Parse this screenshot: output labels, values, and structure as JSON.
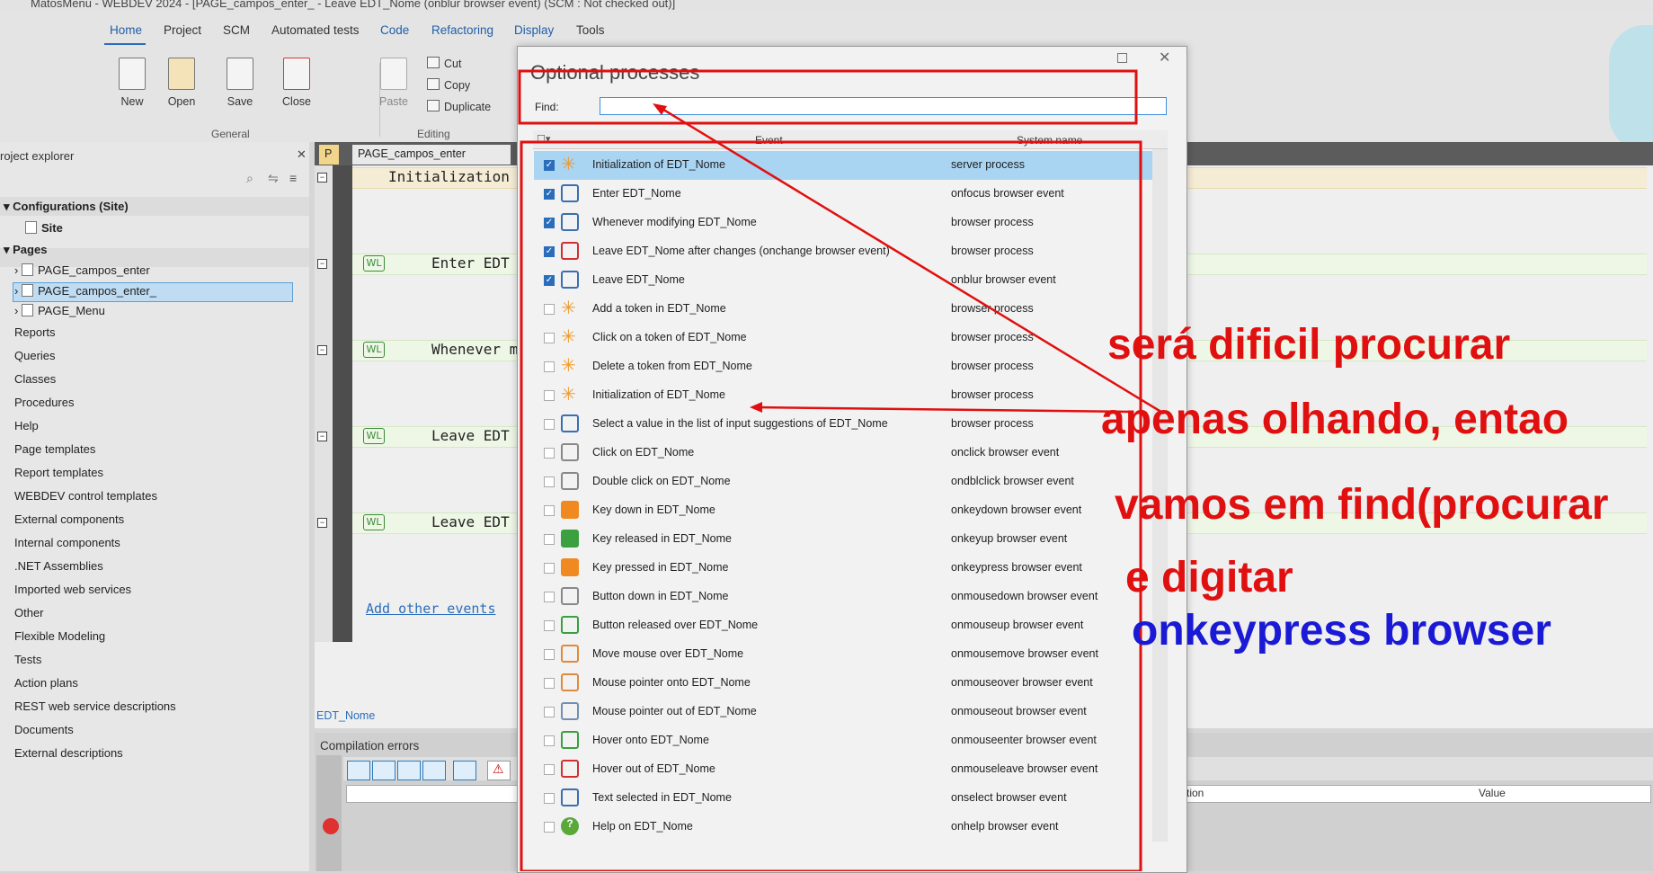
{
  "window": {
    "title": "MatosMenu - WEBDEV 2024 - [PAGE_campos_enter_ - Leave EDT_Nome (onblur browser event) (SCM : Not checked out)]"
  },
  "ribbon": {
    "tabs": [
      "Home",
      "Project",
      "SCM",
      "Automated tests",
      "Code",
      "Refactoring",
      "Display",
      "Tools"
    ],
    "buttons": {
      "new": "New",
      "open": "Open",
      "save": "Save",
      "close": "Close",
      "paste": "Paste",
      "cut": "Cut",
      "copy": "Copy",
      "duplicate": "Duplicate"
    },
    "groups": {
      "general": "General",
      "editing": "Editing"
    }
  },
  "explorer": {
    "title": "roject explorer",
    "config": "Configurations (Site)",
    "site": "Site",
    "pages_header": "Pages",
    "pages": [
      "PAGE_campos_enter",
      "PAGE_campos_enter_",
      "PAGE_Menu"
    ],
    "items": [
      "Reports",
      "Queries",
      "Classes",
      "Procedures",
      "Help",
      "Page templates",
      "Report templates",
      "WEBDEV control templates",
      "External components",
      "Internal components",
      ".NET Assemblies",
      "Imported web services",
      "Other",
      "Flexible Modeling",
      "Tests",
      "Action plans",
      "REST web service descriptions",
      "Documents",
      "External descriptions"
    ]
  },
  "editor": {
    "tab1": "PAGE_campos_enter",
    "lines": [
      {
        "badge": "",
        "text": "Initialization"
      },
      {
        "badge": "WL",
        "text": "Enter EDT"
      },
      {
        "badge": "WL",
        "text": "Whenever m"
      },
      {
        "badge": "WL",
        "text": "Leave EDT"
      },
      {
        "badge": "WL",
        "text": "Leave EDT"
      }
    ],
    "add_events": "Add other events",
    "current_control": "EDT_Nome"
  },
  "compilation": {
    "title": "Compilation errors",
    "col_tion": "tion",
    "col_value": "Value"
  },
  "dialog": {
    "title": "Optional processes",
    "find_label": "Find:",
    "find_value": "",
    "col_event": "Event",
    "col_system": "System name",
    "rows": [
      {
        "checked": true,
        "icon": "star",
        "event": "Initialization of EDT_Nome",
        "system": "server process"
      },
      {
        "checked": true,
        "icon": "eye",
        "event": "Enter EDT_Nome",
        "system": "onfocus browser event"
      },
      {
        "checked": true,
        "icon": "edit",
        "event": "Whenever modifying EDT_Nome",
        "system": "browser process"
      },
      {
        "checked": true,
        "icon": "leave-change",
        "event": "Leave EDT_Nome after changes (onchange browser event)",
        "system": "browser process"
      },
      {
        "checked": true,
        "icon": "eye",
        "event": "Leave EDT_Nome",
        "system": "onblur browser event"
      },
      {
        "checked": false,
        "icon": "star",
        "event": "Add a token in EDT_Nome",
        "system": "browser process"
      },
      {
        "checked": false,
        "icon": "star",
        "event": "Click on a token of EDT_Nome",
        "system": "browser process"
      },
      {
        "checked": false,
        "icon": "star",
        "event": "Delete a token from EDT_Nome",
        "system": "browser process"
      },
      {
        "checked": false,
        "icon": "star",
        "event": "Initialization of EDT_Nome",
        "system": "browser process"
      },
      {
        "checked": false,
        "icon": "list",
        "event": "Select a value in the list of input suggestions of EDT_Nome",
        "system": "browser process"
      },
      {
        "checked": false,
        "icon": "mouse",
        "event": "Click on EDT_Nome",
        "system": "onclick browser event"
      },
      {
        "checked": false,
        "icon": "mouse2",
        "event": "Double click on EDT_Nome",
        "system": "ondblclick browser event"
      },
      {
        "checked": false,
        "icon": "key-orange",
        "event": "Key down in EDT_Nome",
        "system": "onkeydown browser event"
      },
      {
        "checked": false,
        "icon": "key-green",
        "event": "Key released in EDT_Nome",
        "system": "onkeyup browser event"
      },
      {
        "checked": false,
        "icon": "key-hand",
        "event": "Key pressed in EDT_Nome",
        "system": "onkeypress browser event"
      },
      {
        "checked": false,
        "icon": "mouse",
        "event": "Button down in EDT_Nome",
        "system": "onmousedown browser event"
      },
      {
        "checked": false,
        "icon": "mouse-green",
        "event": "Button released over EDT_Nome",
        "system": "onmouseup browser event"
      },
      {
        "checked": false,
        "icon": "mouse-move",
        "event": "Move mouse over EDT_Nome",
        "system": "onmousemove browser event"
      },
      {
        "checked": false,
        "icon": "mouse-move",
        "event": "Mouse pointer onto EDT_Nome",
        "system": "onmouseover browser event"
      },
      {
        "checked": false,
        "icon": "mouse-out",
        "event": "Mouse pointer out of EDT_Nome",
        "system": "onmouseout browser event"
      },
      {
        "checked": false,
        "icon": "hover-in",
        "event": "Hover onto EDT_Nome",
        "system": "onmouseenter browser event"
      },
      {
        "checked": false,
        "icon": "hover-out",
        "event": "Hover out of EDT_Nome",
        "system": "onmouseleave browser event"
      },
      {
        "checked": false,
        "icon": "text-select",
        "event": "Text selected in EDT_Nome",
        "system": "onselect browser event"
      },
      {
        "checked": false,
        "icon": "help",
        "event": "Help on EDT_Nome",
        "system": "onhelp browser event"
      }
    ]
  },
  "annotations": {
    "line1": "será dificil procurar",
    "line2": "apenas olhando, entao",
    "line3": "vamos em find(procurar",
    "line4": "e digitar",
    "line5": "onkeypress browser",
    "red": "#e01010",
    "blue": "#1a1ad6"
  }
}
